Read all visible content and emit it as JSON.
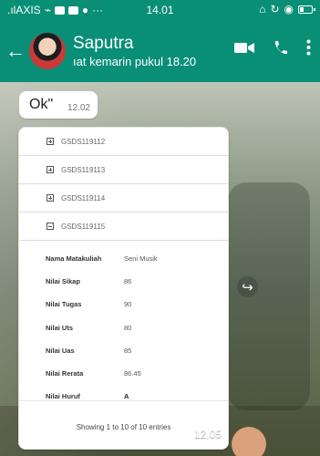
{
  "status_bar": {
    "carrier": ".ılAXIS",
    "wifi_icon": "wifi-icon",
    "app_icons": [
      "square-icon",
      "square-icon",
      "chat-bubble-icon"
    ],
    "more_dots": "···",
    "time": "14.01",
    "right_icons": [
      "alarm-icon",
      "refresh-icon",
      "eye-icon",
      "battery-icon"
    ]
  },
  "header": {
    "back_icon": "arrow-left-icon",
    "contact_name": "Saputra",
    "status": "ıat kemarin pukul 18.20",
    "video_call_icon": "video-camera-icon",
    "call_icon": "phone-icon",
    "menu_icon": "more-vertical-icon"
  },
  "chat": {
    "messages": [
      {
        "text": "Ok\"",
        "time": "12.02"
      },
      {
        "time": "12.05"
      }
    ],
    "image_content": {
      "course_codes": [
        {
          "code": "GSDS119112",
          "state": "plus"
        },
        {
          "code": "GSDS119113",
          "state": "plus"
        },
        {
          "code": "GSDS119114",
          "state": "plus"
        },
        {
          "code": "GSDS119115",
          "state": "minus"
        }
      ],
      "details": [
        {
          "label": "Nama Matakuliah",
          "value": "Seni Musik",
          "emphasis": false
        },
        {
          "label": "Nilai Sikap",
          "value": "86",
          "emphasis": false
        },
        {
          "label": "Nilai Tugas",
          "value": "90",
          "emphasis": false
        },
        {
          "label": "Nilai Uts",
          "value": "80",
          "emphasis": false
        },
        {
          "label": "Nilai Uas",
          "value": "85",
          "emphasis": false
        },
        {
          "label": "Nilai Rerata",
          "value": "86.45",
          "emphasis": false
        },
        {
          "label": "Nilai Huruf",
          "value": "A",
          "emphasis": true
        }
      ],
      "entries_text": "Showing 1 to 10 of 10 entries"
    },
    "forward_icon": "forward-icon"
  },
  "colors": {
    "header": "#0a8f77",
    "bubble": "#ffffff",
    "text_dark": "#222222"
  }
}
